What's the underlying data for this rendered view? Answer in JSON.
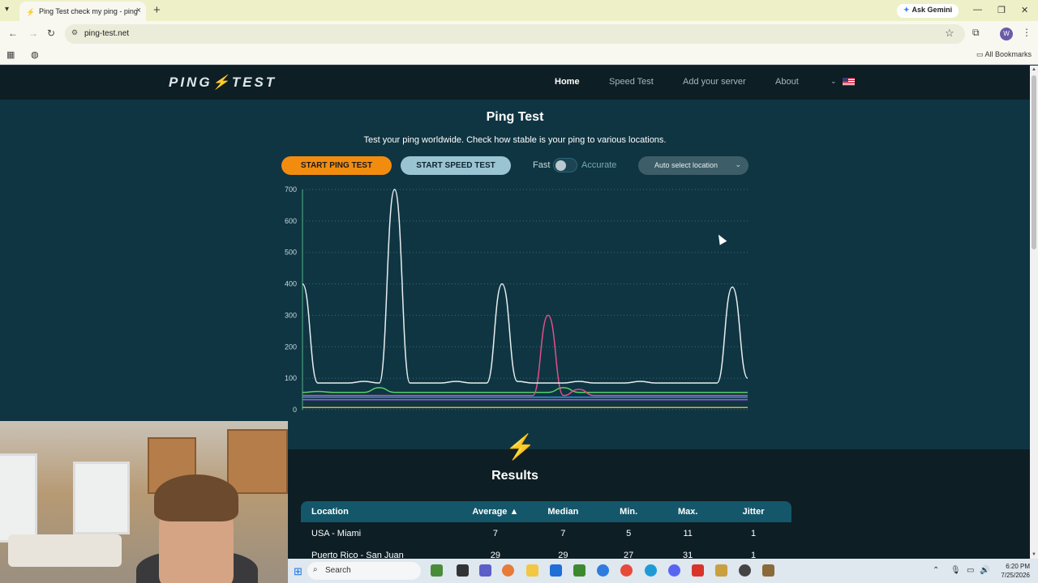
{
  "browser": {
    "tab_title": "Ping Test check my ping - ping",
    "url": "ping-test.net",
    "gemini_label": "Ask Gemini",
    "profile_initial": "W",
    "bookmarks_label": "All Bookmarks"
  },
  "site": {
    "logo": "PING⚡TEST",
    "nav": {
      "home": "Home",
      "speed_test": "Speed Test",
      "add_server": "Add your server",
      "about": "About"
    },
    "title": "Ping Test",
    "subtitle": "Test your ping worldwide. Check how stable is your ping to various locations.",
    "start_ping_label": "START PING TEST",
    "start_speed_label": "START SPEED TEST",
    "mode_fast": "Fast",
    "mode_accurate": "Accurate",
    "mode_accurate_selected": false,
    "location_select": "Auto select location"
  },
  "chart_data": {
    "type": "line",
    "ylim": [
      0,
      700
    ],
    "yticks": [
      0,
      100,
      200,
      300,
      400,
      500,
      600,
      700
    ],
    "grid": true,
    "series": [
      {
        "color": "#e9eef0",
        "values": [
          400,
          85,
          85,
          85,
          90,
          85,
          700,
          85,
          85,
          85,
          90,
          85,
          85,
          400,
          90,
          85,
          85,
          85,
          90,
          85,
          85,
          85,
          90,
          85,
          85,
          85,
          85,
          85,
          390,
          100
        ]
      },
      {
        "color": "#e0508a",
        "values": [
          45,
          45,
          45,
          45,
          45,
          45,
          45,
          45,
          45,
          45,
          45,
          45,
          45,
          45,
          45,
          45,
          300,
          45,
          65,
          45,
          45,
          45,
          45,
          45,
          45,
          45,
          45,
          45,
          45,
          45
        ]
      },
      {
        "color": "#55d06a",
        "values": [
          55,
          58,
          55,
          55,
          55,
          70,
          55,
          55,
          55,
          55,
          55,
          55,
          55,
          55,
          55,
          55,
          55,
          70,
          55,
          55,
          55,
          55,
          55,
          55,
          55,
          55,
          55,
          55,
          55,
          55
        ]
      },
      {
        "color": "#3f8ce8",
        "values": [
          40,
          40,
          40,
          40,
          40,
          40,
          40,
          40,
          40,
          40,
          40,
          40,
          40,
          40,
          40,
          40,
          40,
          40,
          40,
          40,
          40,
          40,
          40,
          40,
          40,
          40,
          40,
          40,
          40,
          40
        ]
      },
      {
        "color": "#a060e0",
        "values": [
          32,
          32,
          32,
          32,
          32,
          32,
          32,
          32,
          32,
          32,
          32,
          32,
          32,
          32,
          32,
          32,
          32,
          32,
          32,
          32,
          32,
          32,
          32,
          32,
          32,
          32,
          32,
          32,
          32,
          32
        ]
      },
      {
        "color": "#d8b040",
        "values": [
          7,
          7,
          7,
          7,
          7,
          7,
          7,
          7,
          7,
          7,
          7,
          7,
          7,
          7,
          7,
          7,
          7,
          7,
          7,
          7,
          7,
          7,
          7,
          7,
          7,
          7,
          7,
          7,
          7,
          7
        ]
      }
    ]
  },
  "results": {
    "title": "Results",
    "columns": [
      "Location",
      "Average ▲",
      "Median",
      "Min.",
      "Max.",
      "Jitter"
    ],
    "rows": [
      [
        "USA - Miami",
        "7",
        "7",
        "5",
        "11",
        "1"
      ],
      [
        "Puerto Rico - San Juan",
        "29",
        "29",
        "27",
        "31",
        "1"
      ]
    ]
  },
  "taskbar": {
    "search_placeholder": "Search",
    "time": "6:20 PM",
    "date": "7/25/2026"
  }
}
